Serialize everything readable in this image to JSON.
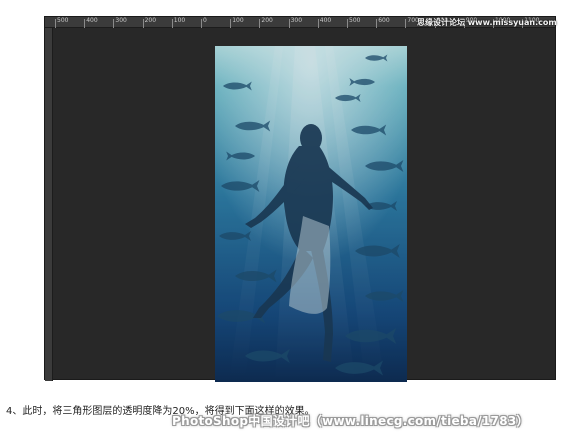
{
  "ruler": {
    "labels": [
      "500",
      "400",
      "300",
      "200",
      "100",
      "0",
      "100",
      "200",
      "300",
      "400",
      "500",
      "600",
      "700",
      "800",
      "900",
      "1000",
      "1100"
    ]
  },
  "watermarks": {
    "top": "思缘设计论坛 www.missyuan.com",
    "bottom": "PhotoShop中国设计吧（www.linecg.com/tieba/1783）"
  },
  "caption": "4、此时，将三角形图层的透明度降为20%，将得到下面这样的效果。",
  "colors": {
    "workspace": "#282828",
    "ruler": "#3b3b3b",
    "water_top": "#8fd4d8",
    "water_deep": "#0e2c52"
  },
  "photo": {
    "description_icon": "underwater-swimmer-with-fish"
  }
}
